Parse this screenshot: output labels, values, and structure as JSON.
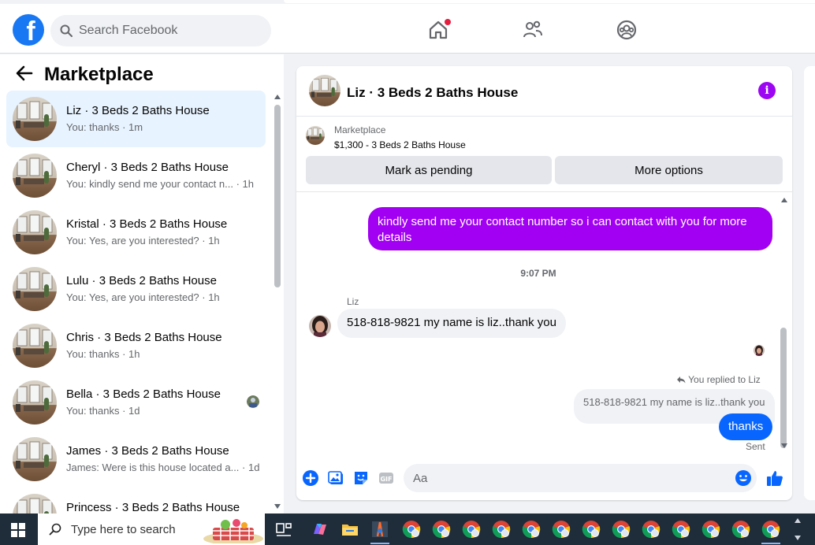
{
  "header": {
    "logo": "f",
    "search_placeholder": "Search Facebook",
    "nav": [
      "home-icon",
      "friends-icon",
      "groups-icon"
    ],
    "notification_color": "#e41e3f"
  },
  "sidebar": {
    "title": "Marketplace",
    "conversations": [
      {
        "name": "Liz · 3 Beds 2 Baths House",
        "preview": "You: thanks · 1m",
        "active": true
      },
      {
        "name": "Cheryl · 3 Beds 2 Baths House",
        "preview": "You: kindly send me your contact n... · 1h"
      },
      {
        "name": "Kristal · 3 Beds 2 Baths House",
        "preview": "You: Yes, are you interested? · 1h"
      },
      {
        "name": "Lulu · 3 Beds 2 Baths House",
        "preview": "You: Yes, are you interested? · 1h"
      },
      {
        "name": "Chris · 3 Beds 2 Baths House",
        "preview": "You: thanks · 1h"
      },
      {
        "name": "Bella · 3 Beds 2 Baths House",
        "preview": "You: thanks · 1d"
      },
      {
        "name": "James · 3 Beds 2 Baths House",
        "preview": "James: Were is this house located a... · 1d"
      },
      {
        "name": "Princess · 3 Beds 2 Baths House",
        "preview": ""
      }
    ]
  },
  "chat": {
    "title": "Liz · 3 Beds 2 Baths House",
    "accent": "#a100f2",
    "listing": {
      "label": "Marketplace",
      "description": "$1,300 - 3 Beds 2 Baths House",
      "pending_button": "Mark as pending",
      "more_button": "More options"
    },
    "messages": {
      "outgoing_1": "kindly send me your contact number so i can contact with you for more details",
      "time": "9:07 PM",
      "sender": "Liz",
      "incoming_1": "518-818-9821 my name is liz..thank you",
      "replied_label": "You replied to Liz",
      "quoted": "518-818-9821 my name is liz..thank you",
      "outgoing_2": "thanks",
      "status": "Sent"
    },
    "composer": {
      "placeholder": "Aa"
    }
  },
  "taskbar": {
    "search_placeholder": "Type here to search"
  }
}
